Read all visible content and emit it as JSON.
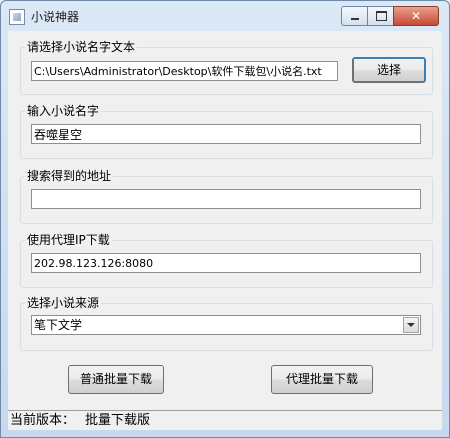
{
  "window": {
    "title": "小说神器"
  },
  "file_group": {
    "label": "请选择小说名字文本",
    "path": "C:\\Users\\Administrator\\Desktop\\软件下载包\\小说名.txt",
    "choose_label": "选择"
  },
  "name_group": {
    "label": "输入小说名字",
    "value": "吞噬星空"
  },
  "address_group": {
    "label": "搜索得到的地址",
    "value": ""
  },
  "proxy_group": {
    "label": "使用代理IP下载",
    "value": "202.98.123.126:8080"
  },
  "source_group": {
    "label": "选择小说来源",
    "selected": "笔下文学"
  },
  "actions": {
    "normal_label": "普通批量下载",
    "proxy_label": "代理批量下载"
  },
  "status": {
    "version_label": "当前版本：",
    "version_value": "批量下载版"
  }
}
